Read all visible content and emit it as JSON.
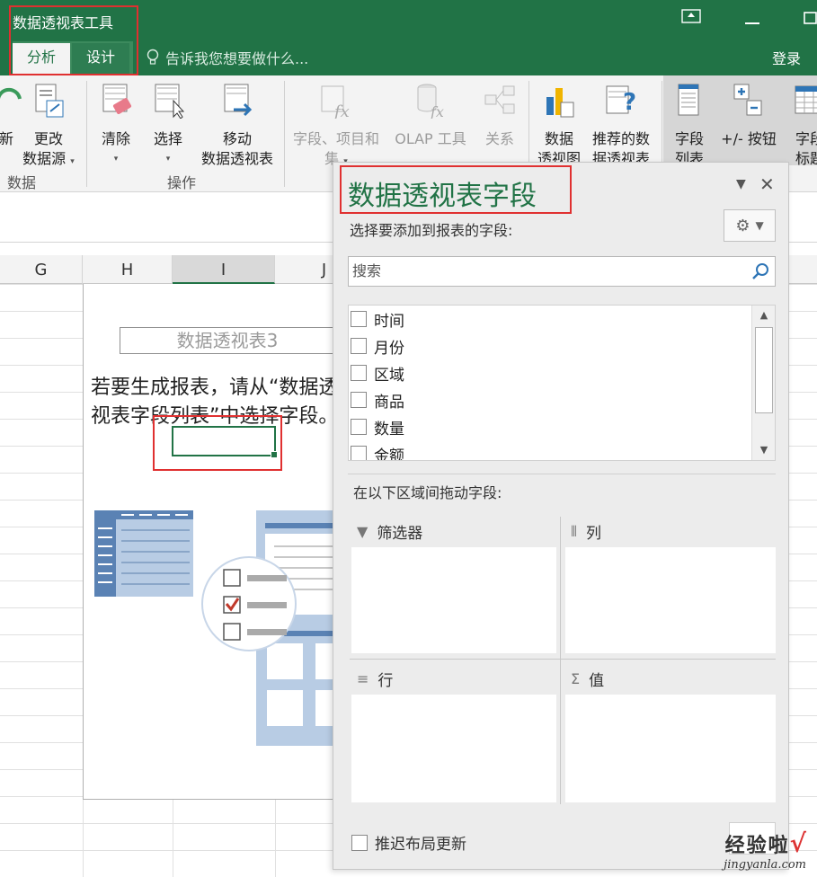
{
  "titlebar": {
    "context_title": "数据透视表工具",
    "tabs": [
      {
        "label": "分析",
        "active": true
      },
      {
        "label": "设计",
        "active": false
      }
    ],
    "tell_me": "告诉我您想要做什么...",
    "login": "登录"
  },
  "ribbon": {
    "buttons": [
      {
        "label1": "新",
        "label2": ""
      },
      {
        "label1": "更改",
        "label2": "数据源"
      },
      {
        "label1": "清除",
        "label2": ""
      },
      {
        "label1": "选择",
        "label2": ""
      },
      {
        "label1": "移动",
        "label2": "数据透视表"
      },
      {
        "label1": "字段、项目和",
        "label2": "集"
      },
      {
        "label1": "OLAP 工具",
        "label2": ""
      },
      {
        "label1": "关系",
        "label2": ""
      },
      {
        "label1": "数据",
        "label2": "透视图"
      },
      {
        "label1": "推荐的数",
        "label2": "据透视表"
      },
      {
        "label1": "字段",
        "label2": "列表"
      },
      {
        "label1": "+/- 按钮",
        "label2": ""
      },
      {
        "label1": "字段",
        "label2": "标题"
      }
    ],
    "groups": {
      "data": "数据",
      "actions": "操作"
    }
  },
  "sheet": {
    "columns": [
      "G",
      "H",
      "I",
      "J"
    ],
    "pivot_name": "数据透视表3",
    "hint_line1": "若要生成报表，请从“数据透",
    "hint_line2": "视表字段列表”中选择字段。"
  },
  "pane": {
    "title": "数据透视表字段",
    "subtitle": "选择要添加到报表的字段:",
    "search_placeholder": "搜索",
    "fields": [
      "时间",
      "月份",
      "区域",
      "商品",
      "数量",
      "金额"
    ],
    "drag_label": "在以下区域间拖动字段:",
    "zones": {
      "filters": "筛选器",
      "columns": "列",
      "rows": "行",
      "values": "值"
    },
    "defer_label": "推迟布局更新"
  },
  "watermark": {
    "cn": "经验啦",
    "check": "√",
    "en": "jingyanla.com"
  },
  "colors": {
    "brand_green": "#217346",
    "highlight_red": "#e03030",
    "illus_blue": "#5a82b4"
  }
}
